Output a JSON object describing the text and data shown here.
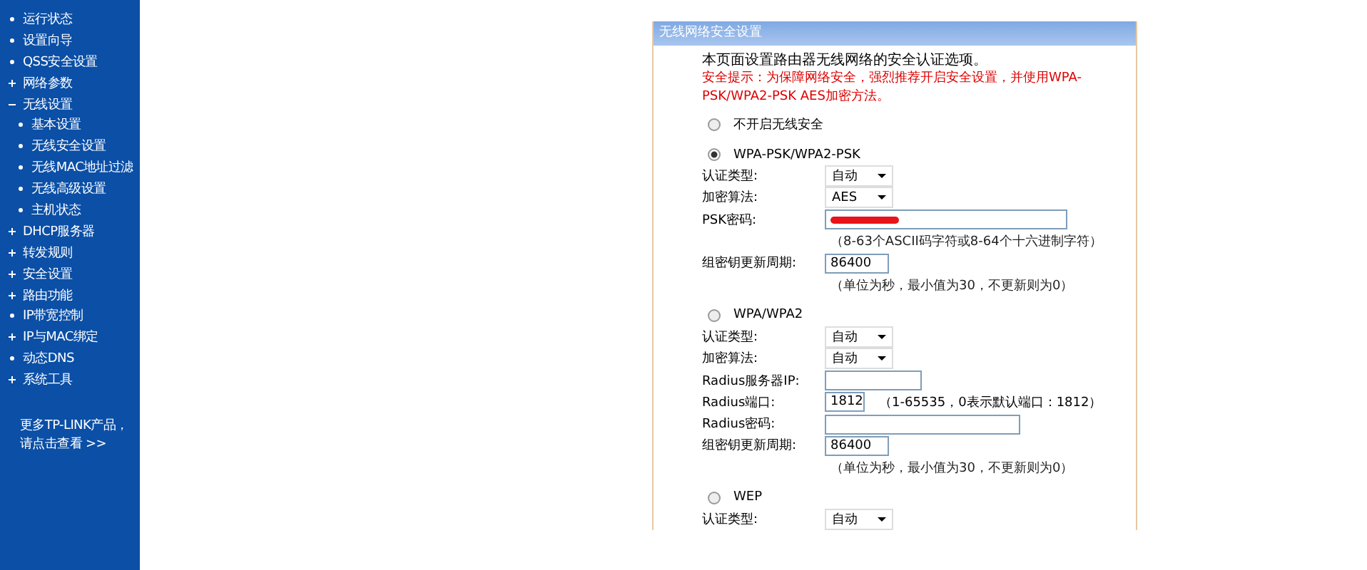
{
  "sidebar": {
    "items": [
      {
        "label": "运行状态",
        "kind": "leaf"
      },
      {
        "label": "设置向导",
        "kind": "leaf"
      },
      {
        "label": "QSS安全设置",
        "kind": "leaf"
      },
      {
        "label": "网络参数",
        "kind": "group",
        "expanded": false
      },
      {
        "label": "无线设置",
        "kind": "group",
        "expanded": true,
        "children": [
          {
            "label": "基本设置",
            "kind": "leaf"
          },
          {
            "label": "无线安全设置",
            "kind": "leaf"
          },
          {
            "label": "无线MAC地址过滤",
            "kind": "leaf"
          },
          {
            "label": "无线高级设置",
            "kind": "leaf"
          },
          {
            "label": "主机状态",
            "kind": "leaf"
          }
        ]
      },
      {
        "label": "DHCP服务器",
        "kind": "group",
        "expanded": false
      },
      {
        "label": "转发规则",
        "kind": "group",
        "expanded": false
      },
      {
        "label": "安全设置",
        "kind": "group",
        "expanded": false
      },
      {
        "label": "路由功能",
        "kind": "group",
        "expanded": false
      },
      {
        "label": "IP带宽控制",
        "kind": "leaf"
      },
      {
        "label": "IP与MAC绑定",
        "kind": "group",
        "expanded": false
      },
      {
        "label": "动态DNS",
        "kind": "leaf"
      },
      {
        "label": "系统工具",
        "kind": "group",
        "expanded": false
      }
    ],
    "more_link": [
      "更多TP-LINK产品，",
      "请点击查看 >>"
    ]
  },
  "panel": {
    "title": "无线网络安全设置",
    "intro": "本页面设置路由器无线网络的安全认证选项。",
    "warning": "安全提示：为保障网络安全，强烈推荐开启安全设置，并使用WPA-PSK/WPA2-PSK AES加密方法。",
    "sections": [
      {
        "label": "不开启无线安全",
        "selected": false
      },
      {
        "label": "WPA-PSK/WPA2-PSK",
        "selected": true,
        "rows": [
          {
            "kind": "select",
            "label": "认证类型:",
            "value": "自动"
          },
          {
            "kind": "select",
            "label": "加密算法:",
            "value": "AES"
          },
          {
            "kind": "masked",
            "label": "PSK密码:"
          },
          {
            "kind": "hint",
            "text": "（8-63个ASCII码字符或8-64个十六进制字符）"
          },
          {
            "kind": "number",
            "label": "组密钥更新周期:",
            "value": "86400"
          },
          {
            "kind": "hint",
            "text": "（单位为秒，最小值为30，不更新则为0）"
          }
        ]
      },
      {
        "label": "WPA/WPA2",
        "selected": false,
        "rows": [
          {
            "kind": "select",
            "label": "认证类型:",
            "value": "自动"
          },
          {
            "kind": "select",
            "label": "加密算法:",
            "value": "自动"
          },
          {
            "kind": "text",
            "label": "Radius服务器IP:"
          },
          {
            "kind": "port",
            "label": "Radius端口:",
            "value": "1812",
            "note": "（1-65535，0表示默认端口：1812）"
          },
          {
            "kind": "password",
            "label": "Radius密码:"
          },
          {
            "kind": "number",
            "label": "组密钥更新周期:",
            "value": "86400"
          },
          {
            "kind": "hint",
            "text": "（单位为秒，最小值为30，不更新则为0）"
          }
        ]
      },
      {
        "label": "WEP",
        "selected": false,
        "rows": [
          {
            "kind": "select",
            "label": "认证类型:",
            "value": "自动"
          }
        ]
      }
    ]
  }
}
